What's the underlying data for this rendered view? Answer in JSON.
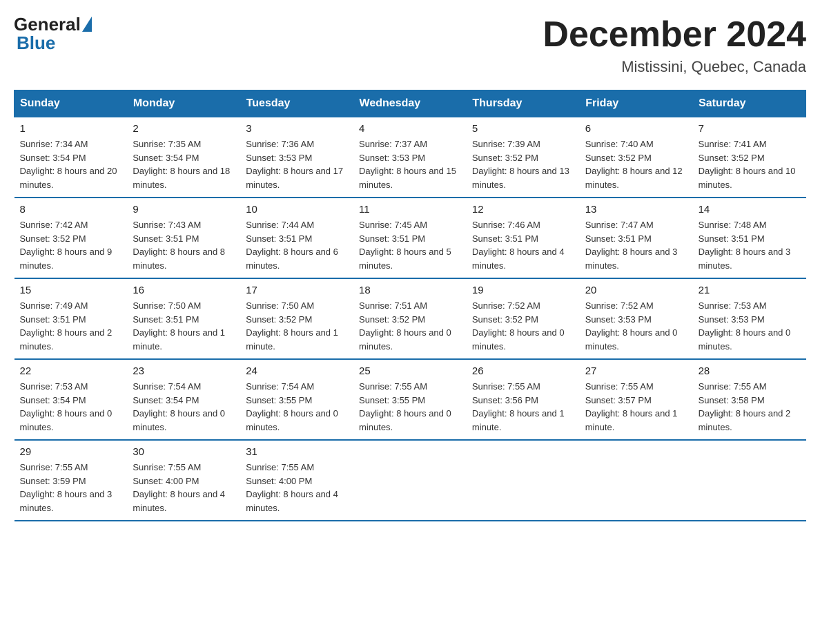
{
  "header": {
    "logo": {
      "general": "General",
      "blue": "Blue"
    },
    "month": "December 2024",
    "location": "Mistissini, Quebec, Canada"
  },
  "weekdays": [
    "Sunday",
    "Monday",
    "Tuesday",
    "Wednesday",
    "Thursday",
    "Friday",
    "Saturday"
  ],
  "weeks": [
    [
      {
        "day": "1",
        "sunrise": "Sunrise: 7:34 AM",
        "sunset": "Sunset: 3:54 PM",
        "daylight": "Daylight: 8 hours and 20 minutes."
      },
      {
        "day": "2",
        "sunrise": "Sunrise: 7:35 AM",
        "sunset": "Sunset: 3:54 PM",
        "daylight": "Daylight: 8 hours and 18 minutes."
      },
      {
        "day": "3",
        "sunrise": "Sunrise: 7:36 AM",
        "sunset": "Sunset: 3:53 PM",
        "daylight": "Daylight: 8 hours and 17 minutes."
      },
      {
        "day": "4",
        "sunrise": "Sunrise: 7:37 AM",
        "sunset": "Sunset: 3:53 PM",
        "daylight": "Daylight: 8 hours and 15 minutes."
      },
      {
        "day": "5",
        "sunrise": "Sunrise: 7:39 AM",
        "sunset": "Sunset: 3:52 PM",
        "daylight": "Daylight: 8 hours and 13 minutes."
      },
      {
        "day": "6",
        "sunrise": "Sunrise: 7:40 AM",
        "sunset": "Sunset: 3:52 PM",
        "daylight": "Daylight: 8 hours and 12 minutes."
      },
      {
        "day": "7",
        "sunrise": "Sunrise: 7:41 AM",
        "sunset": "Sunset: 3:52 PM",
        "daylight": "Daylight: 8 hours and 10 minutes."
      }
    ],
    [
      {
        "day": "8",
        "sunrise": "Sunrise: 7:42 AM",
        "sunset": "Sunset: 3:52 PM",
        "daylight": "Daylight: 8 hours and 9 minutes."
      },
      {
        "day": "9",
        "sunrise": "Sunrise: 7:43 AM",
        "sunset": "Sunset: 3:51 PM",
        "daylight": "Daylight: 8 hours and 8 minutes."
      },
      {
        "day": "10",
        "sunrise": "Sunrise: 7:44 AM",
        "sunset": "Sunset: 3:51 PM",
        "daylight": "Daylight: 8 hours and 6 minutes."
      },
      {
        "day": "11",
        "sunrise": "Sunrise: 7:45 AM",
        "sunset": "Sunset: 3:51 PM",
        "daylight": "Daylight: 8 hours and 5 minutes."
      },
      {
        "day": "12",
        "sunrise": "Sunrise: 7:46 AM",
        "sunset": "Sunset: 3:51 PM",
        "daylight": "Daylight: 8 hours and 4 minutes."
      },
      {
        "day": "13",
        "sunrise": "Sunrise: 7:47 AM",
        "sunset": "Sunset: 3:51 PM",
        "daylight": "Daylight: 8 hours and 3 minutes."
      },
      {
        "day": "14",
        "sunrise": "Sunrise: 7:48 AM",
        "sunset": "Sunset: 3:51 PM",
        "daylight": "Daylight: 8 hours and 3 minutes."
      }
    ],
    [
      {
        "day": "15",
        "sunrise": "Sunrise: 7:49 AM",
        "sunset": "Sunset: 3:51 PM",
        "daylight": "Daylight: 8 hours and 2 minutes."
      },
      {
        "day": "16",
        "sunrise": "Sunrise: 7:50 AM",
        "sunset": "Sunset: 3:51 PM",
        "daylight": "Daylight: 8 hours and 1 minute."
      },
      {
        "day": "17",
        "sunrise": "Sunrise: 7:50 AM",
        "sunset": "Sunset: 3:52 PM",
        "daylight": "Daylight: 8 hours and 1 minute."
      },
      {
        "day": "18",
        "sunrise": "Sunrise: 7:51 AM",
        "sunset": "Sunset: 3:52 PM",
        "daylight": "Daylight: 8 hours and 0 minutes."
      },
      {
        "day": "19",
        "sunrise": "Sunrise: 7:52 AM",
        "sunset": "Sunset: 3:52 PM",
        "daylight": "Daylight: 8 hours and 0 minutes."
      },
      {
        "day": "20",
        "sunrise": "Sunrise: 7:52 AM",
        "sunset": "Sunset: 3:53 PM",
        "daylight": "Daylight: 8 hours and 0 minutes."
      },
      {
        "day": "21",
        "sunrise": "Sunrise: 7:53 AM",
        "sunset": "Sunset: 3:53 PM",
        "daylight": "Daylight: 8 hours and 0 minutes."
      }
    ],
    [
      {
        "day": "22",
        "sunrise": "Sunrise: 7:53 AM",
        "sunset": "Sunset: 3:54 PM",
        "daylight": "Daylight: 8 hours and 0 minutes."
      },
      {
        "day": "23",
        "sunrise": "Sunrise: 7:54 AM",
        "sunset": "Sunset: 3:54 PM",
        "daylight": "Daylight: 8 hours and 0 minutes."
      },
      {
        "day": "24",
        "sunrise": "Sunrise: 7:54 AM",
        "sunset": "Sunset: 3:55 PM",
        "daylight": "Daylight: 8 hours and 0 minutes."
      },
      {
        "day": "25",
        "sunrise": "Sunrise: 7:55 AM",
        "sunset": "Sunset: 3:55 PM",
        "daylight": "Daylight: 8 hours and 0 minutes."
      },
      {
        "day": "26",
        "sunrise": "Sunrise: 7:55 AM",
        "sunset": "Sunset: 3:56 PM",
        "daylight": "Daylight: 8 hours and 1 minute."
      },
      {
        "day": "27",
        "sunrise": "Sunrise: 7:55 AM",
        "sunset": "Sunset: 3:57 PM",
        "daylight": "Daylight: 8 hours and 1 minute."
      },
      {
        "day": "28",
        "sunrise": "Sunrise: 7:55 AM",
        "sunset": "Sunset: 3:58 PM",
        "daylight": "Daylight: 8 hours and 2 minutes."
      }
    ],
    [
      {
        "day": "29",
        "sunrise": "Sunrise: 7:55 AM",
        "sunset": "Sunset: 3:59 PM",
        "daylight": "Daylight: 8 hours and 3 minutes."
      },
      {
        "day": "30",
        "sunrise": "Sunrise: 7:55 AM",
        "sunset": "Sunset: 4:00 PM",
        "daylight": "Daylight: 8 hours and 4 minutes."
      },
      {
        "day": "31",
        "sunrise": "Sunrise: 7:55 AM",
        "sunset": "Sunset: 4:00 PM",
        "daylight": "Daylight: 8 hours and 4 minutes."
      },
      {
        "day": "",
        "sunrise": "",
        "sunset": "",
        "daylight": ""
      },
      {
        "day": "",
        "sunrise": "",
        "sunset": "",
        "daylight": ""
      },
      {
        "day": "",
        "sunrise": "",
        "sunset": "",
        "daylight": ""
      },
      {
        "day": "",
        "sunrise": "",
        "sunset": "",
        "daylight": ""
      }
    ]
  ]
}
